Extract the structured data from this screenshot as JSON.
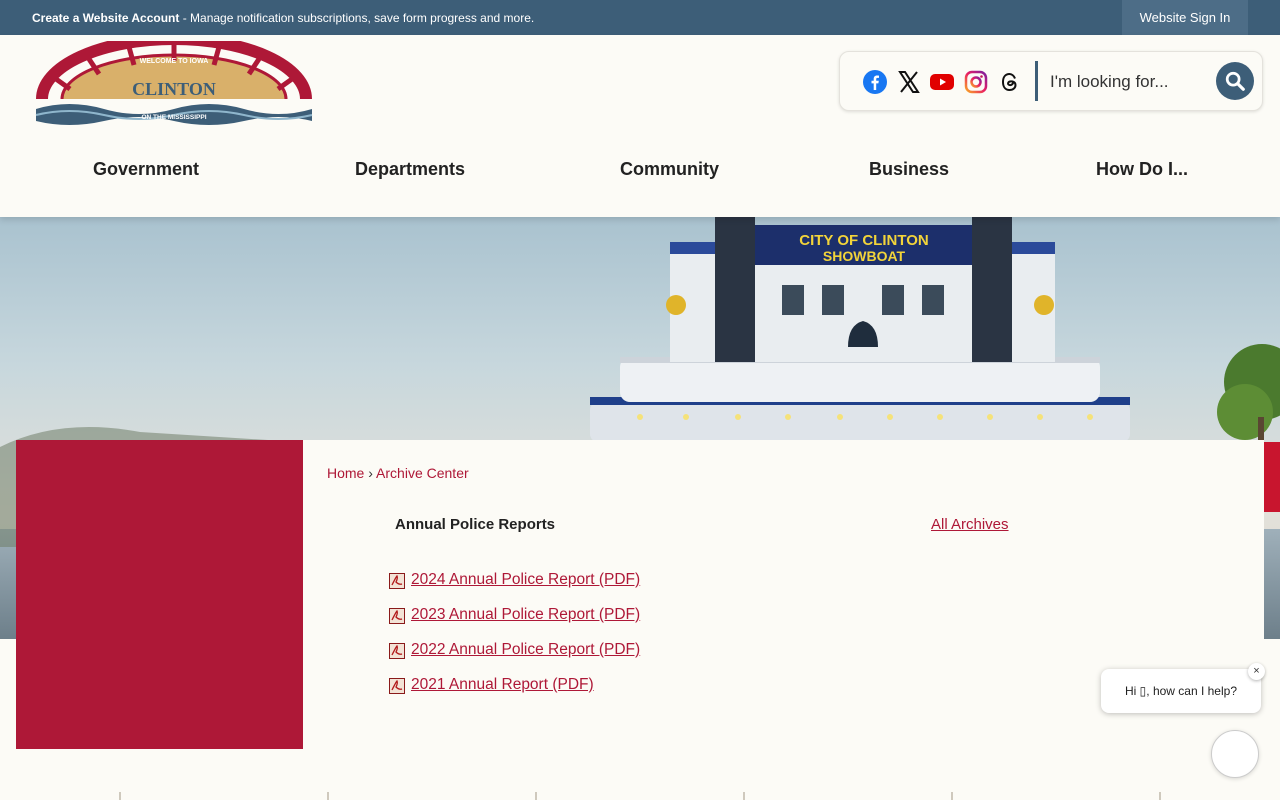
{
  "topbar": {
    "account_link": "Create a Website Account",
    "account_desc": " - Manage notification subscriptions, save form progress and more.",
    "signin": "Website Sign In"
  },
  "logo": {
    "top_text": "WELCOME TO IOWA",
    "name": "CLINTON",
    "bottom_text": "ON THE MISSISSIPPI"
  },
  "social": [
    "facebook-icon",
    "x-icon",
    "youtube-icon",
    "instagram-icon",
    "threads-icon"
  ],
  "search": {
    "placeholder": "I'm looking for..."
  },
  "nav": [
    {
      "label": "Government"
    },
    {
      "label": "Departments"
    },
    {
      "label": "Community"
    },
    {
      "label": "Business"
    },
    {
      "label": "How Do I..."
    }
  ],
  "hero": {
    "sign_line1": "CITY OF CLINTON",
    "sign_line2": "SHOWBOAT"
  },
  "breadcrumb": {
    "home": "Home",
    "sep": "›",
    "current": "Archive Center"
  },
  "archive": {
    "title": "Annual Police Reports",
    "all_link": "All Archives",
    "items": [
      {
        "label": "2024 Annual Police Report (PDF)"
      },
      {
        "label": "2023 Annual Police Report (PDF)"
      },
      {
        "label": "2022 Annual Police Report (PDF)"
      },
      {
        "label": "2021 Annual Report (PDF)"
      }
    ]
  },
  "chat": {
    "message": "Hi ▯, how can I help?",
    "close": "×"
  },
  "colors": {
    "brand_blue": "#3d5e78",
    "brand_red": "#ae1837",
    "background": "#fcfbf6"
  }
}
